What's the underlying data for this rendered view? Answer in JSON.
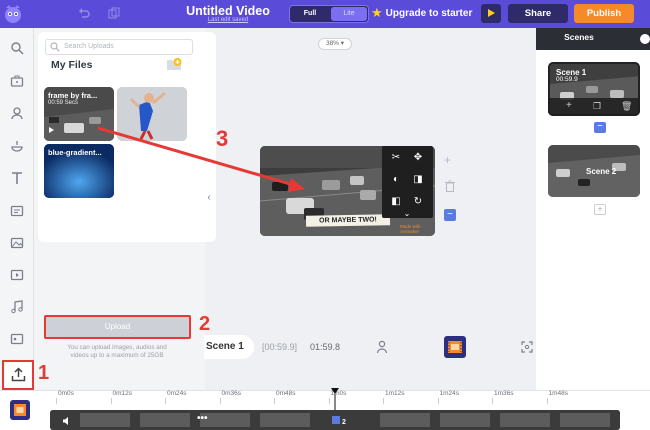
{
  "header": {
    "title": "Untitled Video",
    "save_status": "Last edit saved",
    "mode_full": "Full",
    "mode_lite": "Lite",
    "upgrade_label": "Upgrade to starter",
    "share_label": "Share",
    "publish_label": "Publish",
    "accent_color": "#5b4bd9",
    "publish_color": "#f6892a"
  },
  "rail": {
    "items": [
      "search-icon",
      "briefcase-icon",
      "character-icon",
      "props-icon",
      "text-icon",
      "templates-icon",
      "image-icon",
      "video-icon",
      "music-icon",
      "color-icon"
    ],
    "upload_icon": "upload-icon"
  },
  "uploads": {
    "search_placeholder": "Search Uploads",
    "section_title": "My Files",
    "files": [
      {
        "name": "frame by fra...",
        "duration": "00:59 Secs"
      },
      {
        "name": "",
        "duration": ""
      },
      {
        "name": "blue-gradient...",
        "duration": ""
      }
    ],
    "upload_button": "Upload",
    "upload_note": "You can upload images, audios and videos up to a maximum of 25GB"
  },
  "canvas": {
    "zoom": "38%",
    "caption": "OR MAYBE TWO!",
    "watermark": "Made with Animaker"
  },
  "scene_row": {
    "scene_label": "Scene 1",
    "current_time": "[00:59.9]",
    "total_time": "01:59.8"
  },
  "scenes_panel": {
    "title": "Scenes",
    "scenes": [
      {
        "name": "Scene 1",
        "duration": "00:59.9"
      },
      {
        "name": "Scene 2",
        "duration": ""
      }
    ]
  },
  "timeline": {
    "ticks": [
      "0m0s",
      "0m12s",
      "0m24s",
      "0m36s",
      "0m48s",
      "1m0s",
      "1m12s",
      "1m24s",
      "1m36s",
      "1m48s"
    ],
    "scene_count": "2"
  },
  "annotations": {
    "step1": "1",
    "step2": "2",
    "step3": "3",
    "color": "#e53935"
  }
}
